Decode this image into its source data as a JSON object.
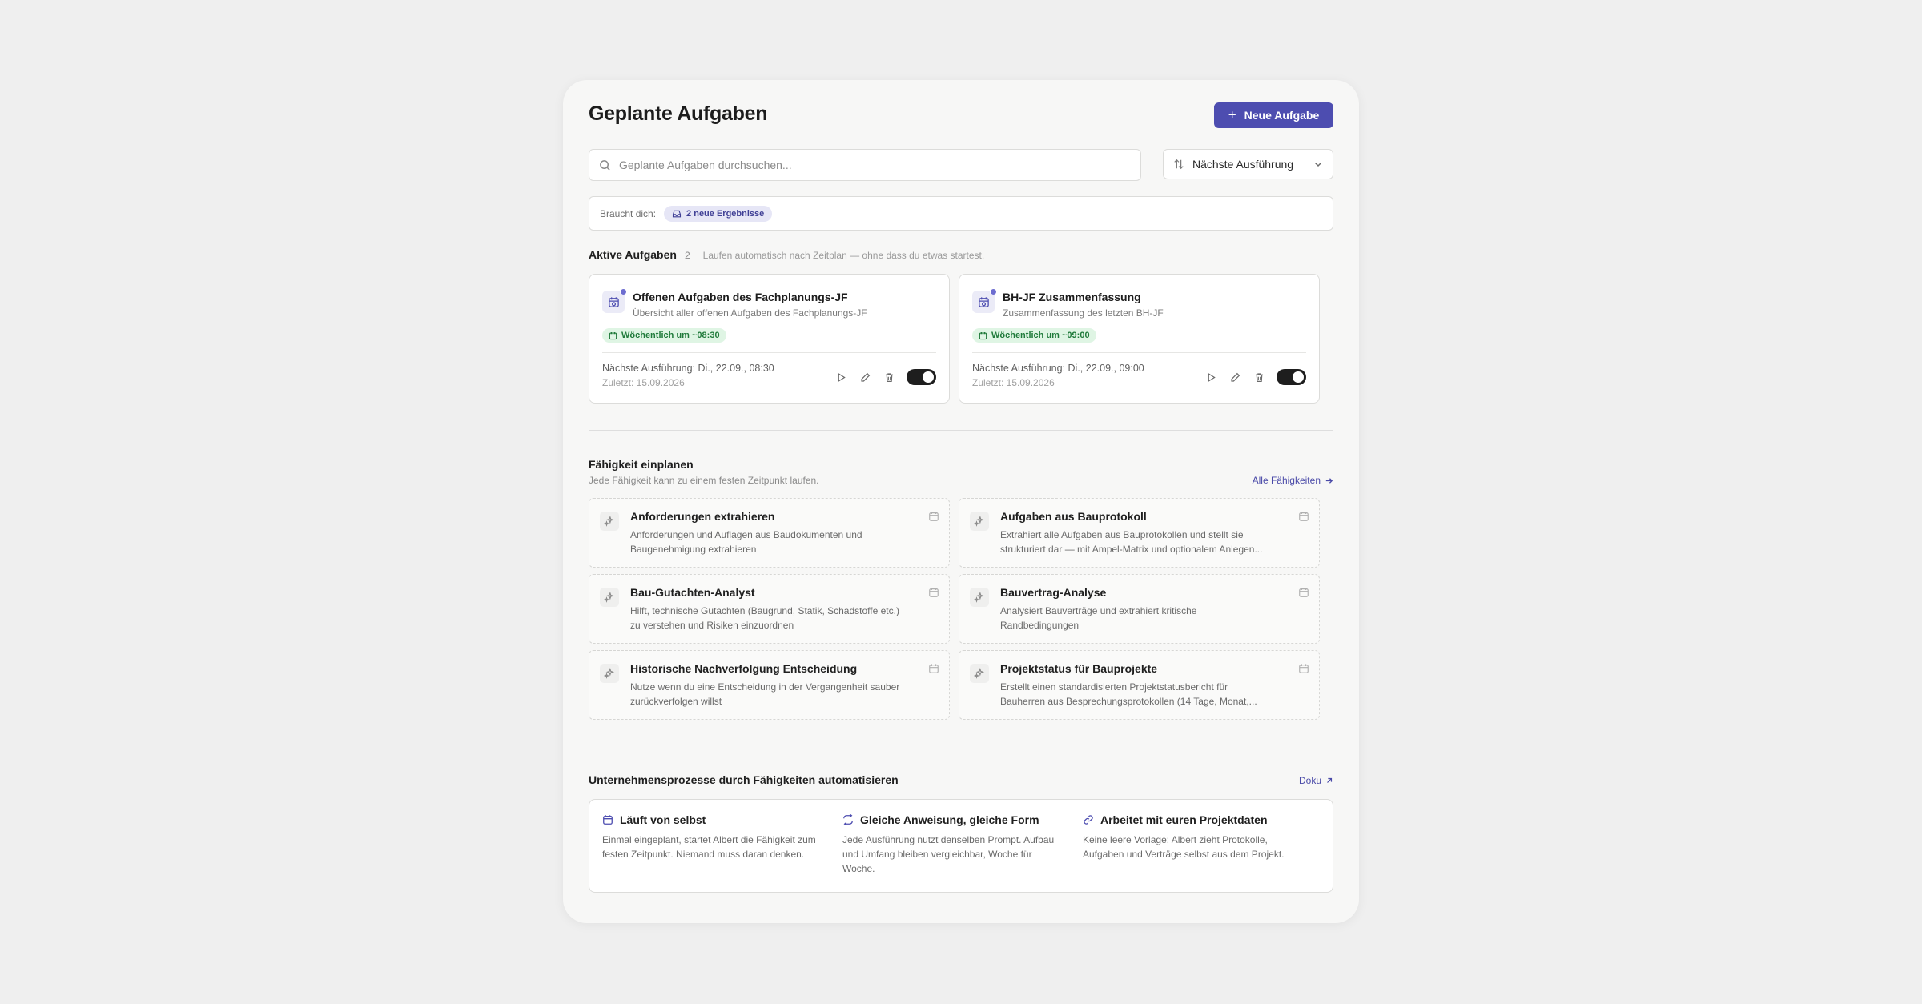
{
  "header": {
    "title": "Geplante Aufgaben",
    "new_button_label": "Neue Aufgabe"
  },
  "search": {
    "placeholder": "Geplante Aufgaben durchsuchen...",
    "value": ""
  },
  "sort": {
    "selected": "Nächste Ausführung"
  },
  "needs_you": {
    "label": "Braucht dich:",
    "badge": "2 neue Ergebnisse"
  },
  "active": {
    "title": "Aktive Aufgaben",
    "count": "2",
    "note": "Laufen automatisch nach Zeitplan — ohne dass du etwas startest.",
    "tasks": [
      {
        "title": "Offenen Aufgaben des Fachplanungs-JF",
        "subtitle": "Übersicht aller offenen Aufgaben des Fachplanungs-JF",
        "schedule": "Wöchentlich um ~08:30",
        "next_run": "Nächste Ausführung: Di., 22.09., 08:30",
        "last_run": "Zuletzt: 15.09.2026",
        "enabled": true
      },
      {
        "title": "BH-JF Zusammenfassung",
        "subtitle": "Zusammenfassung des letzten BH-JF",
        "schedule": "Wöchentlich um ~09:00",
        "next_run": "Nächste Ausführung: Di., 22.09., 09:00",
        "last_run": "Zuletzt: 15.09.2026",
        "enabled": true
      }
    ]
  },
  "skills": {
    "title": "Fähigkeit einplanen",
    "subtitle": "Jede Fähigkeit kann zu einem festen Zeitpunkt laufen.",
    "all_link": "Alle Fähigkeiten",
    "items": [
      {
        "title": "Anforderungen extrahieren",
        "desc": "Anforderungen und Auflagen aus Baudokumenten und Baugenehmigung extrahieren"
      },
      {
        "title": "Aufgaben aus Bauprotokoll",
        "desc": "Extrahiert alle Aufgaben aus Bauprotokollen und stellt sie strukturiert dar — mit Ampel-Matrix und optionalem Anlegen..."
      },
      {
        "title": "Bau-Gutachten-Analyst",
        "desc": "Hilft, technische Gutachten (Baugrund, Statik, Schadstoffe etc.) zu verstehen und Risiken einzuordnen"
      },
      {
        "title": "Bauvertrag-Analyse",
        "desc": "Analysiert Bauverträge und extrahiert kritische Randbedingungen"
      },
      {
        "title": "Historische Nachverfolgung Entscheidung",
        "desc": "Nutze wenn du eine Entscheidung in der Vergangenheit sauber zurückverfolgen willst"
      },
      {
        "title": "Projektstatus für Bauprojekte",
        "desc": "Erstellt einen standardisierten Projektstatusbericht für Bauherren aus Besprechungsprotokollen (14 Tage, Monat,..."
      }
    ]
  },
  "processes": {
    "title": "Unternehmensprozesse durch Fähigkeiten automatisieren",
    "doku_link": "Doku",
    "features": [
      {
        "icon": "calendar-icon",
        "title": "Läuft von selbst",
        "desc": "Einmal eingeplant, startet Albert die Fähigkeit zum festen Zeitpunkt. Niemand muss daran denken."
      },
      {
        "icon": "repeat-icon",
        "title": "Gleiche Anweisung, gleiche Form",
        "desc": "Jede Ausführung nutzt denselben Prompt. Aufbau und Umfang bleiben vergleichbar, Woche für Woche."
      },
      {
        "icon": "link-icon",
        "title": "Arbeitet mit euren Projektdaten",
        "desc": "Keine leere Vorlage: Albert zieht Protokolle, Aufgaben und Verträge selbst aus dem Projekt."
      }
    ]
  },
  "colors": {
    "accent": "#4d4db0",
    "schedule_bg": "#dff5e4",
    "schedule_text": "#1f7a3a",
    "toggle_on": "#1e1e1e"
  }
}
